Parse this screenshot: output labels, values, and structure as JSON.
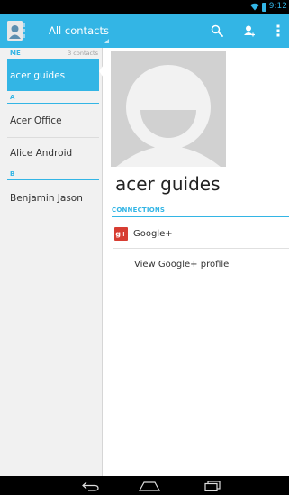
{
  "status_bar": {
    "time": "9:12",
    "icons": [
      "wifi-icon",
      "battery-icon"
    ]
  },
  "action_bar": {
    "title": "All contacts",
    "icons": [
      "contacts-app-icon",
      "search-icon",
      "add-contact-icon",
      "overflow-menu-icon"
    ]
  },
  "sidebar": {
    "me_section": {
      "letter": "ME",
      "count": "3 contacts"
    },
    "selected_contact": "acer guides",
    "section_a": {
      "letter": "A"
    },
    "a_contacts": [
      "Acer Office",
      "Alice Android"
    ],
    "section_b": {
      "letter": "B"
    },
    "b_contacts": [
      "Benjamin Jason"
    ]
  },
  "detail": {
    "name": "acer guides",
    "connections_header": "CONNECTIONS",
    "connection": {
      "logo": "g+",
      "label": "Google+"
    },
    "view_profile": "View Google+ profile"
  },
  "nav_bar": {
    "icons": [
      "back-icon",
      "home-icon",
      "recent-apps-icon"
    ]
  },
  "colors": {
    "accent": "#33b5e5",
    "google_plus": "#d73d32",
    "photo_bg": "#d1d1d1"
  }
}
